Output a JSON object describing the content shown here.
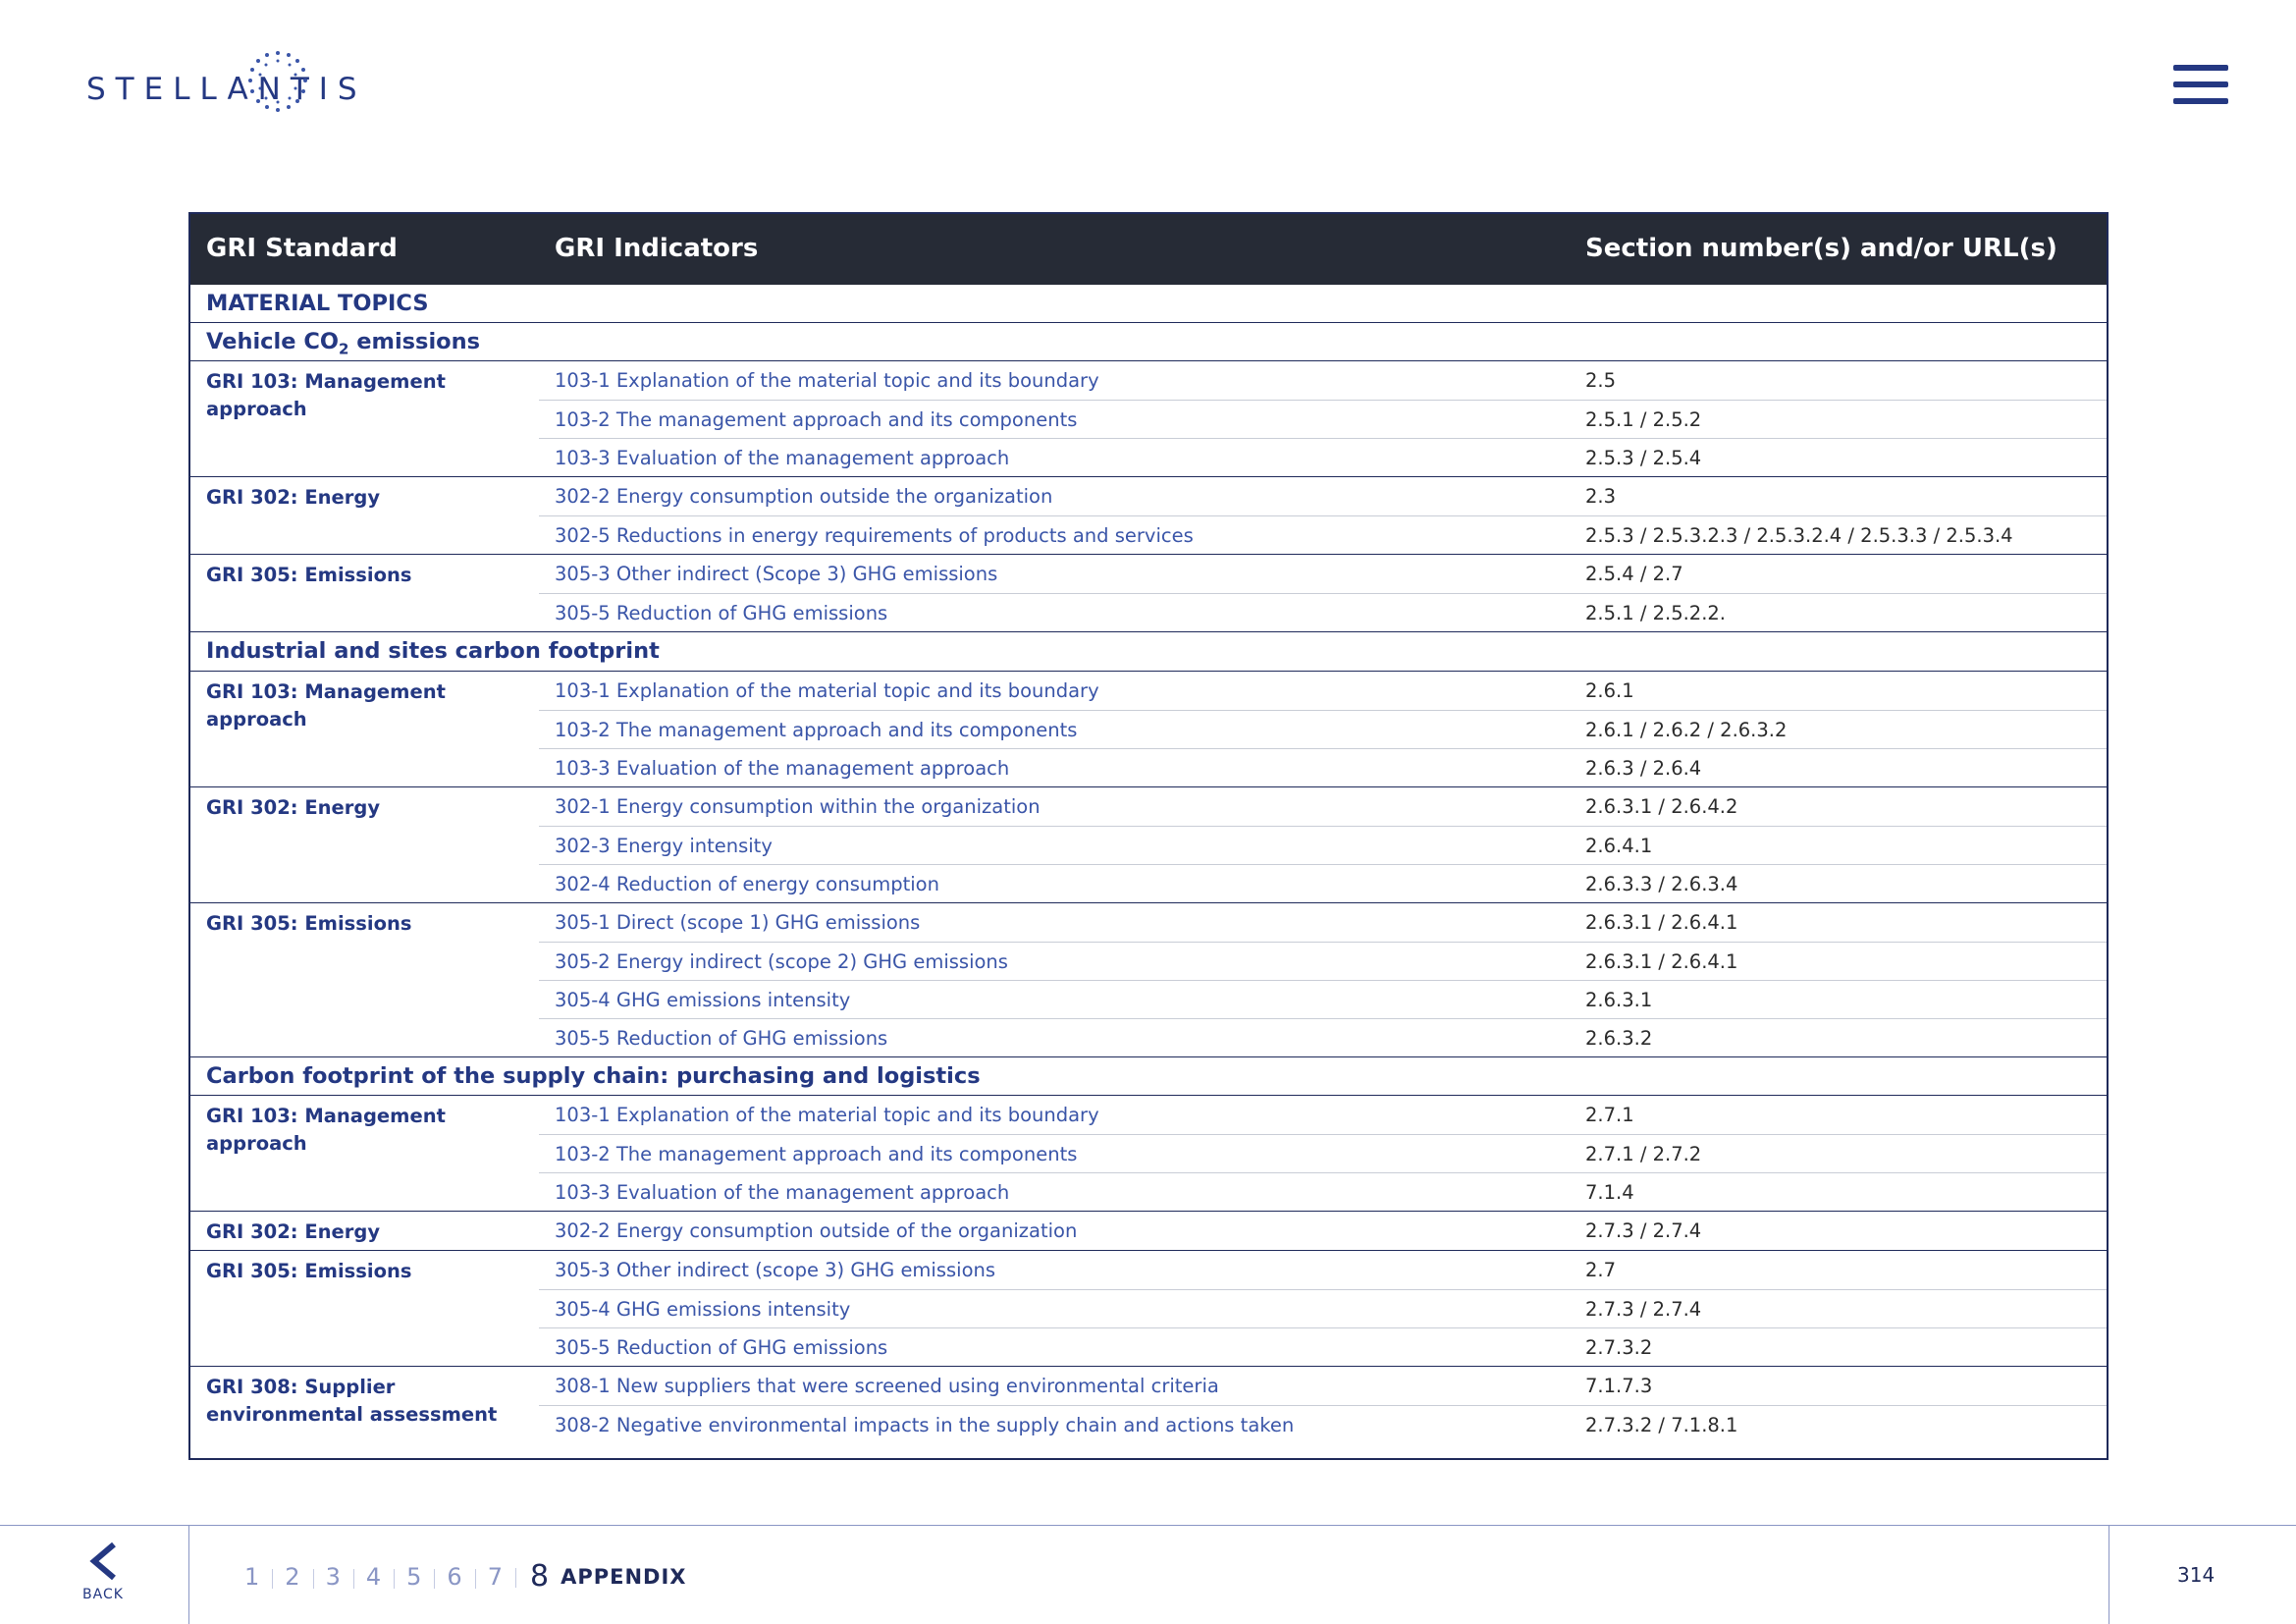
{
  "header": {
    "logo_text": "STELLANTIS",
    "menu_icon": "hamburger-menu-icon"
  },
  "table": {
    "columns": [
      "GRI Standard",
      "GRI Indicators",
      "Section number(s) and/or URL(s)"
    ],
    "material_topics": "MATERIAL TOPICS",
    "topics": [
      {
        "title": "Vehicle CO",
        "title_sub": "2",
        "title_suffix": " emissions",
        "groups": [
          {
            "standard": "GRI 103: Management approach",
            "rows": [
              {
                "indicator": "103-1 Explanation of the material topic and its boundary",
                "section": "2.5"
              },
              {
                "indicator": "103-2 The management approach and its components",
                "section": "2.5.1 / 2.5.2"
              },
              {
                "indicator": "103-3 Evaluation of the management approach",
                "section": "2.5.3 / 2.5.4"
              }
            ]
          },
          {
            "standard": "GRI 302: Energy",
            "rows": [
              {
                "indicator": "302-2  Energy consumption outside the organization",
                "section": "2.3"
              },
              {
                "indicator": "302-5  Reductions in energy requirements of products and services",
                "section": "2.5.3 / 2.5.3.2.3 / 2.5.3.2.4 / 2.5.3.3 / 2.5.3.4"
              }
            ]
          },
          {
            "standard": "GRI 305: Emissions",
            "rows": [
              {
                "indicator": "305-3  Other indirect (Scope 3) GHG emissions",
                "section": "2.5.4 / 2.7"
              },
              {
                "indicator": "305-5  Reduction of GHG emissions",
                "section": "2.5.1 / 2.5.2.2."
              }
            ]
          }
        ]
      },
      {
        "title": "Industrial and sites carbon footprint",
        "groups": [
          {
            "standard": "GRI 103: Management approach",
            "rows": [
              {
                "indicator": "103-1 Explanation of the material topic and its boundary",
                "section": "2.6.1"
              },
              {
                "indicator": "103-2 The management approach and its components",
                "section": "2.6.1 / 2.6.2 / 2.6.3.2"
              },
              {
                "indicator": "103-3 Evaluation of the management approach",
                "section": "2.6.3 / 2.6.4"
              }
            ]
          },
          {
            "standard": "GRI 302: Energy",
            "rows": [
              {
                "indicator": "302-1  Energy consumption within the organization",
                "section": "2.6.3.1 / 2.6.4.2"
              },
              {
                "indicator": "302-3  Energy intensity",
                "section": "2.6.4.1"
              },
              {
                "indicator": "302-4  Reduction of energy consumption",
                "section": "2.6.3.3 / 2.6.3.4"
              }
            ]
          },
          {
            "standard": "GRI 305: Emissions",
            "rows": [
              {
                "indicator": "305-1 Direct (scope 1) GHG emissions",
                "section": "2.6.3.1 / 2.6.4.1"
              },
              {
                "indicator": "305-2 Energy indirect (scope 2) GHG emissions",
                "section": "2.6.3.1 / 2.6.4.1"
              },
              {
                "indicator": "305-4 GHG emissions intensity",
                "section": "2.6.3.1"
              },
              {
                "indicator": "305-5 Reduction of GHG emissions",
                "section": "2.6.3.2"
              }
            ]
          }
        ]
      },
      {
        "title": "Carbon footprint of the supply chain: purchasing and logistics",
        "groups": [
          {
            "standard": "GRI 103: Management approach",
            "rows": [
              {
                "indicator": "103-1 Explanation of the material topic and its boundary",
                "section": "2.7.1"
              },
              {
                "indicator": "103-2 The management approach and its components",
                "section": "2.7.1 / 2.7.2"
              },
              {
                "indicator": "103-3 Evaluation of the management approach",
                "section": "7.1.4"
              }
            ]
          },
          {
            "standard": "GRI 302: Energy",
            "rows": [
              {
                "indicator": "302-2 Energy consumption outside of the organization",
                "section": "2.7.3 / 2.7.4"
              }
            ]
          },
          {
            "standard": "GRI 305: Emissions",
            "rows": [
              {
                "indicator": "305-3 Other indirect (scope 3) GHG emissions",
                "section": "2.7"
              },
              {
                "indicator": "305-4 GHG emissions intensity",
                "section": "2.7.3 / 2.7.4"
              },
              {
                "indicator": "305-5 Reduction of GHG emissions",
                "section": "2.7.3.2"
              }
            ]
          },
          {
            "standard": "GRI 308: Supplier environmental assessment",
            "rows": [
              {
                "indicator": "308-1 New suppliers that were screened using environmental criteria",
                "section": "7.1.7.3"
              },
              {
                "indicator": "308-2 Negative environmental impacts in the supply chain and actions taken",
                "section": "2.7.3.2 / 7.1.8.1"
              }
            ]
          }
        ]
      }
    ]
  },
  "footer": {
    "back_label": "BACK",
    "chapters": [
      "1",
      "2",
      "3",
      "4",
      "5",
      "6",
      "7"
    ],
    "active_chapter": "8",
    "active_label": "APPENDIX",
    "page_number": "314"
  }
}
